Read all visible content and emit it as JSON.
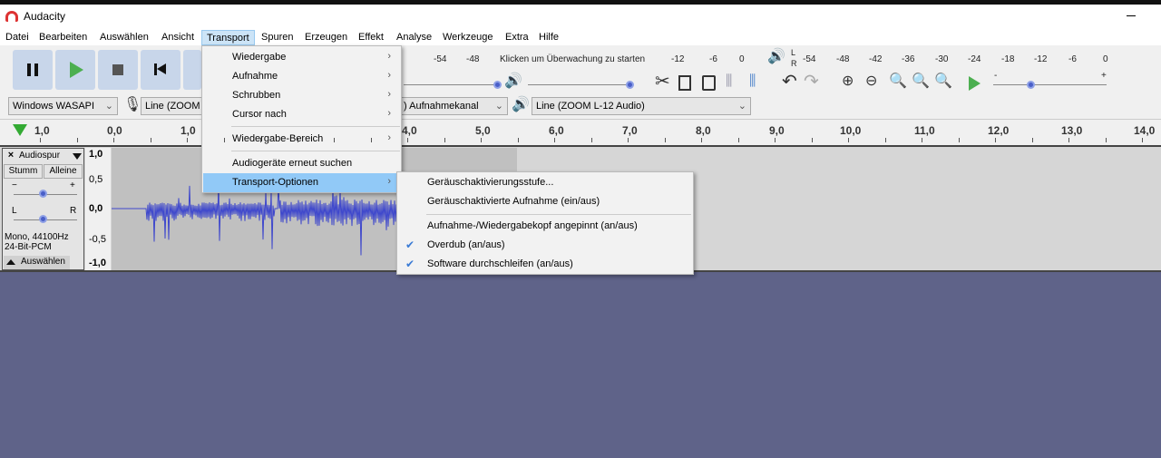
{
  "window": {
    "title": "Audacity"
  },
  "menubar": [
    "Datei",
    "Bearbeiten",
    "Auswählen",
    "Ansicht",
    "Transport",
    "Spuren",
    "Erzeugen",
    "Effekt",
    "Analyse",
    "Werkzeuge",
    "Extra",
    "Hilfe"
  ],
  "transport_menu": {
    "items": [
      {
        "label": "Wiedergabe",
        "submenu": true
      },
      {
        "label": "Aufnahme",
        "submenu": true
      },
      {
        "label": "Schrubben",
        "submenu": true
      },
      {
        "label": "Cursor nach",
        "submenu": true
      },
      {
        "label": "Wiedergabe-Bereich",
        "submenu": true
      },
      {
        "label": "Audiogeräte erneut suchen",
        "submenu": false
      },
      {
        "label": "Transport-Optionen",
        "submenu": true,
        "highlighted": true
      }
    ]
  },
  "transport_options_menu": {
    "items": [
      {
        "label": "Geräuschaktivierungsstufe...",
        "checked": false
      },
      {
        "label": "Geräuschaktivierte Aufnahme (ein/aus)",
        "checked": false
      },
      {
        "label": "Aufnahme-/Wiedergabekopf angepinnt (an/aus)",
        "checked": false
      },
      {
        "label": "Overdub (an/aus)",
        "checked": true
      },
      {
        "label": "Software durchschleifen (an/aus)",
        "checked": true
      }
    ]
  },
  "record_meter": {
    "ticks_left": [
      "-54",
      "-48"
    ],
    "prompt": "Klicken um Überwachung zu starten",
    "ticks_right": [
      "-12",
      "-6",
      "0"
    ]
  },
  "play_meter": {
    "channels": [
      "L",
      "R"
    ],
    "ticks": [
      "-54",
      "-48",
      "-42",
      "-36",
      "-30",
      "-24",
      "-18",
      "-12",
      "-6",
      "0"
    ]
  },
  "devices": {
    "host": "Windows WASAPI",
    "input": "Line (ZOOM",
    "channels": ") Aufnahmekanal",
    "output": "Line (ZOOM L-12 Audio)"
  },
  "ruler": [
    "1,0",
    "0,0",
    "1,0",
    "4,0",
    "5,0",
    "6,0",
    "7,0",
    "8,0",
    "9,0",
    "10,0",
    "11,0",
    "12,0",
    "13,0",
    "14,0"
  ],
  "track": {
    "name": "Audiospur",
    "mute": "Stumm",
    "solo": "Alleine",
    "gain_minus": "−",
    "gain_plus": "+",
    "pan_l": "L",
    "pan_r": "R",
    "info1": "Mono, 44100Hz",
    "info2": "24-Bit-PCM",
    "select": "Auswählen",
    "scale": [
      "1,0",
      "0,5",
      "0,0",
      "-0,5",
      "-1,0"
    ]
  },
  "slider_signs": {
    "minus": "-",
    "plus": "+"
  },
  "colors": {
    "waveform": "#3f48cc",
    "menu_highlight": "#91c9f7",
    "background": "#5f6389"
  }
}
